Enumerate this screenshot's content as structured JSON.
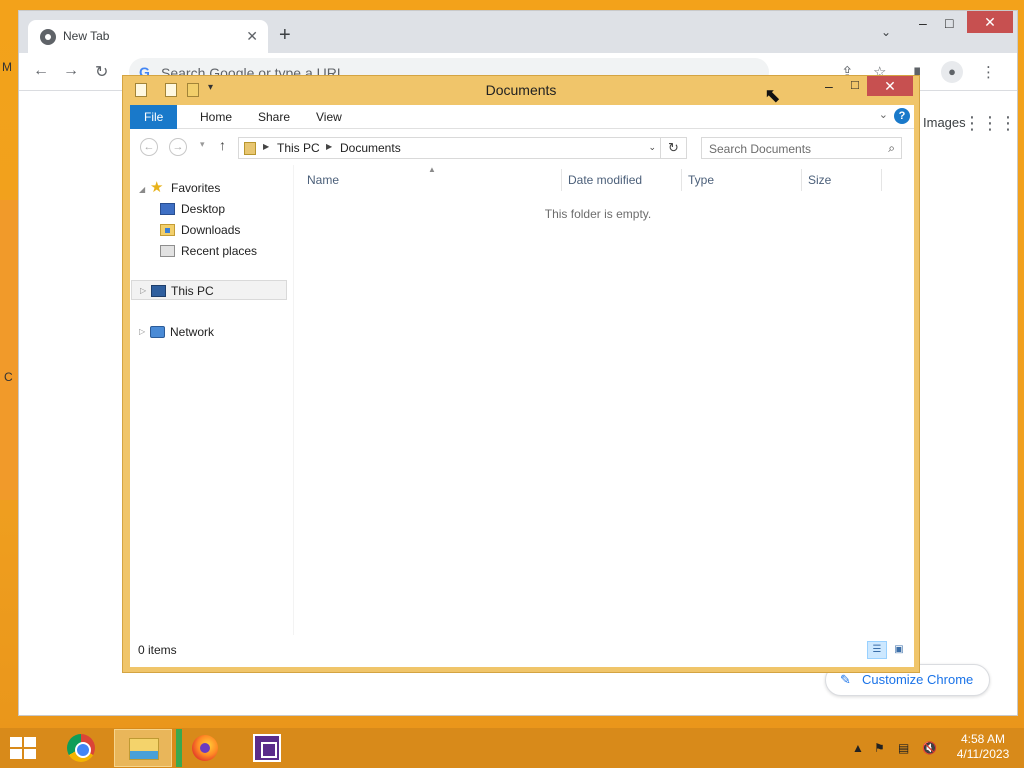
{
  "chrome": {
    "tab_title": "New Tab",
    "tab_close": "✕",
    "new_tab": "+",
    "tab_search": "⌄",
    "minimize": "–",
    "maximize": "□",
    "close": "✕",
    "omnibox_icon": "G",
    "omnibox_placeholder": "Search Google or type a URL",
    "images_link": "Images",
    "customize_label": "Customize Chrome"
  },
  "explorer": {
    "title": "Documents",
    "minimize": "–",
    "maximize": "□",
    "close": "✕",
    "ribbon_tabs": [
      "File",
      "Home",
      "Share",
      "View"
    ],
    "help": "?",
    "breadcrumb": [
      "This PC",
      "Documents"
    ],
    "search_placeholder": "Search Documents",
    "nav": {
      "favorites": "Favorites",
      "desktop": "Desktop",
      "downloads": "Downloads",
      "recent_places": "Recent places",
      "this_pc": "This PC",
      "network": "Network"
    },
    "columns": [
      "Name",
      "Date modified",
      "Type",
      "Size"
    ],
    "empty_message": "This folder is empty.",
    "status": "0 items"
  },
  "taskbar": {
    "apps": [
      "chrome-icon",
      "file-explorer-icon",
      "firefox-icon",
      "virtualbox-icon"
    ],
    "clock_time": "4:58 AM",
    "clock_date": "4/11/2023"
  },
  "colors": {
    "desktop": "#f0a020",
    "explorer_frame": "#f0c56a",
    "ribbon_file": "#1979ca",
    "close_button": "#c75050",
    "taskbar": "#d88a1a"
  }
}
